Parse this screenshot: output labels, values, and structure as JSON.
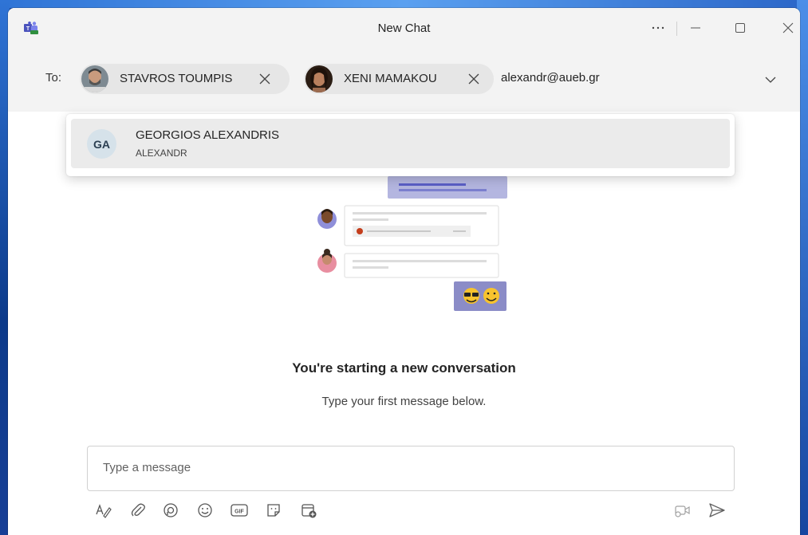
{
  "window": {
    "title": "New Chat"
  },
  "to_bar": {
    "label": "To:",
    "recipients": [
      {
        "name": "STAVROS TOUMPIS"
      },
      {
        "name": "XENI MAMAKOU"
      }
    ],
    "typed_text": "alexandr@aueb.gr"
  },
  "suggestion": {
    "initials": "GA",
    "name": "GEORGIOS ALEXANDRIS",
    "subtitle": "ALEXANDR"
  },
  "main": {
    "heading": "You're starting a new conversation",
    "subheading": "Type your first message below."
  },
  "compose": {
    "placeholder": "Type a message"
  },
  "colors": {
    "accent": "#5b5fc7",
    "teams_purple": "#8b8cc7"
  },
  "icons": [
    "teams-icon",
    "more-icon",
    "minimize-icon",
    "maximize-icon",
    "close-icon",
    "remove-icon",
    "chevron-down-icon",
    "format-icon",
    "attach-icon",
    "loop-icon",
    "emoji-icon",
    "gif-icon",
    "sticker-icon",
    "schedule-meeting-icon",
    "video-clip-icon",
    "send-icon"
  ]
}
